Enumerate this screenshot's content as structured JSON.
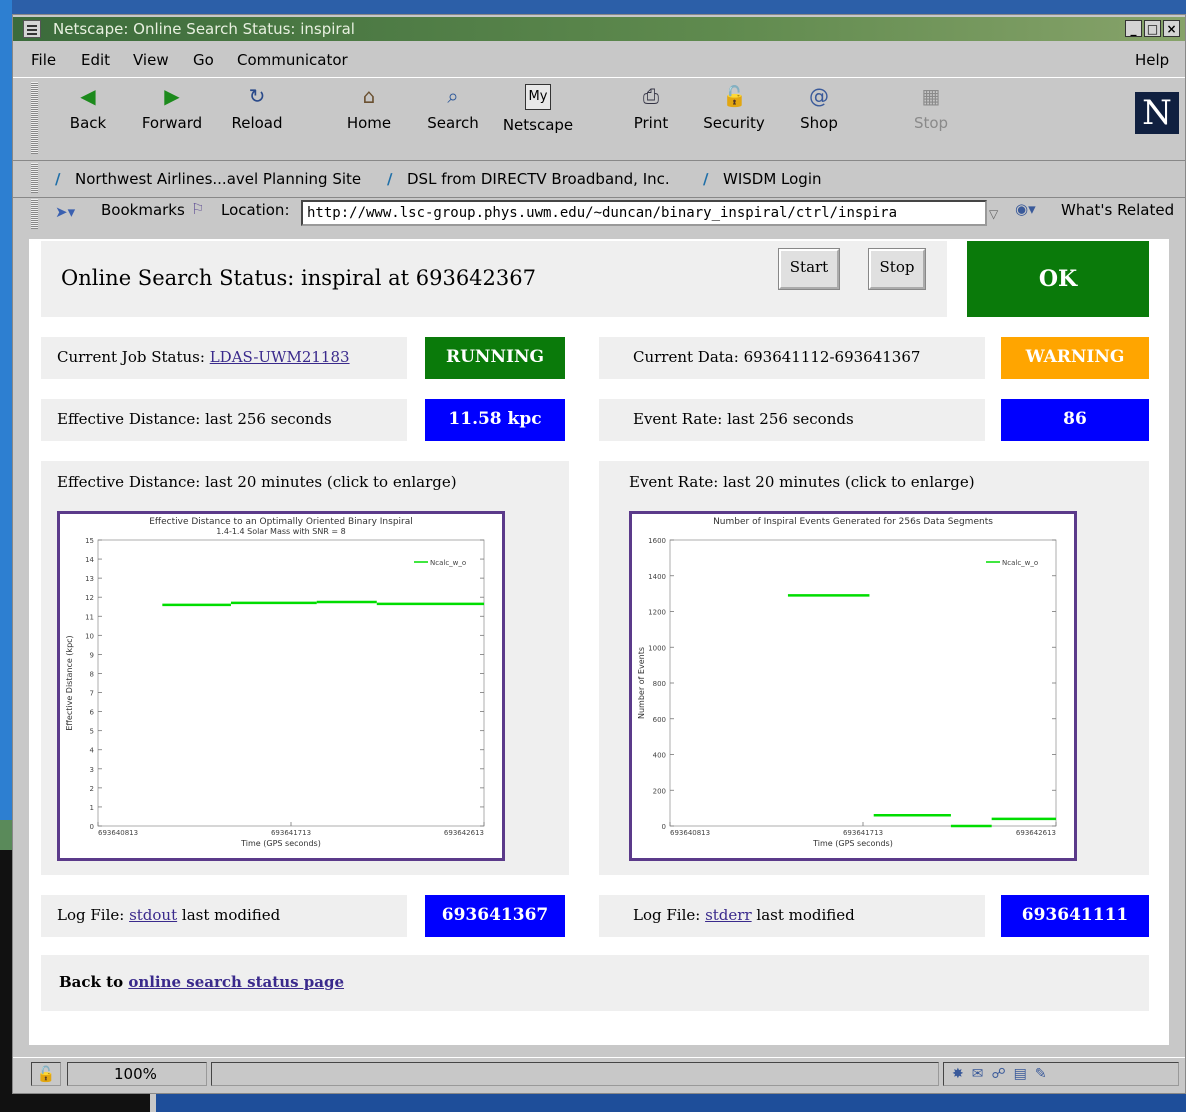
{
  "window": {
    "title": "Netscape: Online Search Status: inspiral"
  },
  "menu": {
    "file": "File",
    "edit": "Edit",
    "view": "View",
    "go": "Go",
    "communicator": "Communicator",
    "help": "Help"
  },
  "toolbar": {
    "back": "Back",
    "forward": "Forward",
    "reload": "Reload",
    "home": "Home",
    "search": "Search",
    "netscape": "Netscape",
    "print": "Print",
    "security": "Security",
    "shop": "Shop",
    "stop": "Stop"
  },
  "personal_toolbar": {
    "links": [
      "Northwest Airlines...avel Planning Site",
      "DSL from DIRECTV Broadband, Inc.",
      "WISDM Login"
    ]
  },
  "location_bar": {
    "bookmarks_label": "Bookmarks",
    "location_label": "Location:",
    "url": "http://www.lsc-group.phys.uwm.edu/~duncan/binary_inspiral/ctrl/inspira",
    "whats_related": "What's Related"
  },
  "page": {
    "title": "Online Search Status: inspiral at 693642367",
    "start_label": "Start",
    "stop_label": "Stop",
    "overall_status": "OK",
    "job_status_label": "Current Job Status:",
    "job_status_link": "LDAS-UWM21183",
    "job_status_value": "RUNNING",
    "current_data_label": "Current Data: 693641112-693641367",
    "current_data_value": "WARNING",
    "eff_dist_label": "Effective Distance: last 256 seconds",
    "eff_dist_value": "11.58 kpc",
    "event_rate_label": "Event Rate: last 256 seconds",
    "event_rate_value": "86",
    "eff_dist_plot_label": "Effective Distance: last 20 minutes (click to enlarge)",
    "event_rate_plot_label": "Event Rate: last 20 minutes (click to enlarge)",
    "log_file_label": "Log File:",
    "stdout_link": "stdout",
    "stderr_link": "stderr",
    "last_modified": "last modified",
    "stdout_value": "693641367",
    "stderr_value": "693641111",
    "back_to_label": "Back to",
    "back_link": "online search status page"
  },
  "chart_data": [
    {
      "type": "line",
      "title": "Effective Distance to an Optimally Oriented Binary Inspiral",
      "subtitle": "1.4-1.4 Solar Mass with SNR = 8",
      "xlabel": "Time (GPS seconds)",
      "ylabel": "Effective Distance (kpc)",
      "x_tick_labels": [
        "693640813",
        "693641713",
        "693642613"
      ],
      "xlim": [
        693640813,
        693642613
      ],
      "ylim": [
        0,
        15
      ],
      "y_ticks": [
        0,
        1,
        2,
        3,
        4,
        5,
        6,
        7,
        8,
        9,
        10,
        11,
        12,
        13,
        14,
        15
      ],
      "series": [
        {
          "name": "Ncalc_w_o",
          "color": "#00dd00",
          "segments": [
            [
              [
                693641113,
                11.6
              ],
              [
                693641433,
                11.6
              ]
            ],
            [
              [
                693641433,
                11.7
              ],
              [
                693641833,
                11.7
              ]
            ],
            [
              [
                693641833,
                11.75
              ],
              [
                693642113,
                11.75
              ]
            ],
            [
              [
                693642113,
                11.65
              ],
              [
                693642613,
                11.65
              ]
            ]
          ]
        }
      ]
    },
    {
      "type": "line",
      "title": "Number of Inspiral Events Generated for 256s Data Segments",
      "xlabel": "Time (GPS seconds)",
      "ylabel": "Number of Events",
      "x_tick_labels": [
        "693640813",
        "693641713",
        "693642613"
      ],
      "xlim": [
        693640813,
        693642613
      ],
      "ylim": [
        0,
        1600
      ],
      "y_ticks": [
        0,
        200,
        400,
        600,
        800,
        1000,
        1200,
        1400,
        1600
      ],
      "series": [
        {
          "name": "Ncalc_w_o",
          "color": "#00dd00",
          "segments": [
            [
              [
                693641363,
                1290
              ],
              [
                693641743,
                1290
              ]
            ],
            [
              [
                693641763,
                60
              ],
              [
                693642123,
                60
              ]
            ],
            [
              [
                693642123,
                0
              ],
              [
                693642313,
                0
              ]
            ],
            [
              [
                693642313,
                40
              ],
              [
                693642613,
                40
              ]
            ]
          ]
        }
      ]
    }
  ],
  "statusbar": {
    "zoom": "100%"
  },
  "colors": {
    "ok_green": "#0a7a0a",
    "warning_orange": "#ffa500",
    "value_blue": "#0000ff",
    "plot_line": "#00dd00",
    "plot_border": "#5b3a8a"
  }
}
